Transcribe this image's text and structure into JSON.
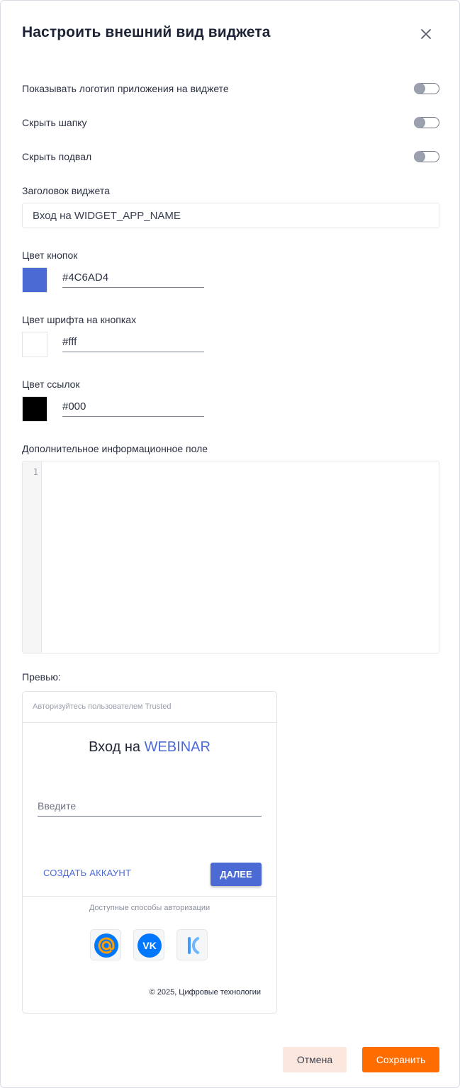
{
  "dialog": {
    "title": "Настроить внешний вид виджета"
  },
  "toggles": [
    {
      "label": "Показывать логотип приложения на виджете",
      "on": false
    },
    {
      "label": "Скрыть шапку",
      "on": false
    },
    {
      "label": "Скрыть подвал",
      "on": false
    }
  ],
  "widget_title": {
    "label": "Заголовок виджета",
    "value": "Вход на WIDGET_APP_NAME"
  },
  "colors": [
    {
      "label": "Цвет кнопок",
      "value": "#4C6AD4",
      "swatch": "#4C6AD4"
    },
    {
      "label": "Цвет шрифта на кнопках",
      "value": "#fff",
      "swatch": "#ffffff"
    },
    {
      "label": "Цвет ссылок",
      "value": "#000",
      "swatch": "#000000"
    }
  ],
  "extra_field": {
    "label": "Дополнительное информационное поле",
    "line_number": "1"
  },
  "preview": {
    "label": "Превью:",
    "header": "Авторизуйтесь пользователем Trusted",
    "title_prefix": "Вход на ",
    "title_app": "WEBINAR",
    "input_placeholder": "Введите",
    "create_account": "СОЗДАТЬ АККАУНТ",
    "next": "ДАЛЕЕ",
    "methods_label": "Доступные способы авторизации",
    "social": [
      {
        "name": "mail-ru",
        "icon": "at-sign-icon",
        "color": "#0077ff"
      },
      {
        "name": "vk",
        "icon": "vk-icon",
        "color": "#0077ff"
      },
      {
        "name": "kontur",
        "icon": "k-icon",
        "color": "#3e9bff"
      }
    ],
    "footer": "© 2025, Цифровые технологии"
  },
  "actions": {
    "cancel": "Отмена",
    "save": "Сохранить"
  },
  "accent_colors": {
    "primary": "#4C6AD4",
    "save": "#FF6C00",
    "cancel_bg": "#FBE7DE"
  }
}
